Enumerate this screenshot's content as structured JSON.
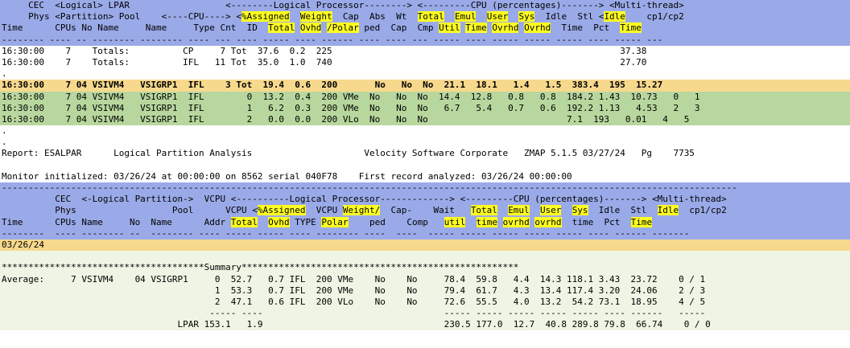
{
  "colors": {
    "header": "#9aaae8",
    "summary_row": "#f7d98e",
    "detail_row": "#b8d79e",
    "report_bg": "#eef5e4",
    "highlight": "#ffff20"
  },
  "top_header": {
    "line1": [
      {
        "t": "     CEC  ",
        "h": false
      },
      {
        "t": "Phys <Partition> LPAR     <----CPU----> <",
        "h": false
      },
      {
        "t": "%Assigned",
        "h": true
      },
      {
        "t": "  ",
        "h": false
      },
      {
        "t": "Weight",
        "h": true
      },
      {
        "t": "  Cap  Abs  Wt  ",
        "h": false
      },
      {
        "t": "Total",
        "h": true
      },
      {
        "t": "  ",
        "h": false
      },
      {
        "t": "Emul",
        "h": true
      },
      {
        "t": "  ",
        "h": false
      },
      {
        "t": "User",
        "h": true
      },
      {
        "t": "  ",
        "h": false
      },
      {
        "t": "Sys",
        "h": true
      },
      {
        "t": "  Idle  Stl <",
        "h": false
      },
      {
        "t": "Idle",
        "h": true
      },
      {
        "t": "    cp1/cp2",
        "h": false
      }
    ],
    "line0": "     CEC  <Logical> LPAR                  <--------Logical Processor--------> <---------CPU (percentages)-------> <Multi-thread>",
    "line1_text": "     Phys <Partition> Pool    <----CPU---->",
    "line2": "Time      CPUs No Name     Name     Type Cnt  ID  ",
    "line2_hl": [
      {
        "t": "Total",
        "h": true
      },
      {
        "t": " ",
        "h": false
      },
      {
        "t": "Ovhd",
        "h": true
      },
      {
        "t": " ",
        "h": false
      },
      {
        "t": "/Polar",
        "h": true
      },
      {
        "t": " ped  Cap  Cmp ",
        "h": false
      },
      {
        "t": "Util",
        "h": true
      },
      {
        "t": " ",
        "h": false
      },
      {
        "t": "Time",
        "h": true
      },
      {
        "t": " ",
        "h": false
      },
      {
        "t": "Ovrhd",
        "h": true
      },
      {
        "t": " ",
        "h": false
      },
      {
        "t": "Ovrhd",
        "h": true
      },
      {
        "t": "  Time  Pct  ",
        "h": false
      },
      {
        "t": "Time",
        "h": true
      }
    ],
    "dashes": "-------- ---- -- -------- -------- ---- --- ---- ----- ---- ------ ---- ---- --- ----- ---- ----- ----- ----- ---- ----- ---"
  },
  "top_rows": [
    {
      "style": "white",
      "text": "16:30:00    7    Totals:          CP     7 Tot  37.6  0.2  225                                                      37.38"
    },
    {
      "style": "white",
      "text": "16:30:00    7    Totals:          IFL   11 Tot  35.0  1.0  740                                                      27.70"
    },
    {
      "style": "white",
      "text": "."
    },
    {
      "style": "orange",
      "text": "16:30:00    7 04 VSIVM4   VSIGRP1  IFL    3 Tot  19.4  0.6  200       No   No  No  21.1  18.1   1.4   1.5  383.4  195  15.27",
      "bold": true
    },
    {
      "style": "green",
      "text": "16:30:00    7 04 VSIVM4   VSIGRP1  IFL        0  13.2  0.4  200 VMe  No   No  No  14.4  12.8   0.8   0.8  184.2 1.43  10.73   0   1"
    },
    {
      "style": "green",
      "text": "16:30:00    7 04 VSIVM4   VSIGRP1  IFL        1   6.2  0.3  200 VMe  No   No  No   6.7   5.4   0.7   0.6  192.2 1.13   4.53   2   3"
    },
    {
      "style": "green",
      "text": "16:30:00    7 04 VSIVM4   VSIGRP1  IFL        2   0.0  0.0  200 VLo  No   No  No                          7.1  193   0.01   4   5"
    },
    {
      "style": "white",
      "text": "."
    },
    {
      "style": "white",
      "text": "."
    }
  ],
  "report": {
    "report_line": "Report: ESALPAR      Logical Partition Analysis                     Velocity Software Corporate   ZMAP 5.1.5 03/27/24   Pg    7735",
    "blank": "",
    "monitor_line": "Monitor initialized: 03/26/24 at 00:00:00 on 8562 serial 040F78    First record analyzed: 03/26/24 00:00:00",
    "rule": "------------------------------------------------------------------------------------------------------------------------------------------"
  },
  "second_header": {
    "line0": "          CEC  <-Logical Partition->  VCPU <----------Logical Processor-------------> <---------CPU (percentages)-------> <Multi-thread>",
    "line1": [
      {
        "t": "          Phys                  Pool      VCPU <",
        "h": false
      },
      {
        "t": "%Assigned",
        "h": true
      },
      {
        "t": "  VCPU ",
        "h": false
      },
      {
        "t": "Weight/",
        "h": true
      },
      {
        "t": "  Cap-    Wait   ",
        "h": false
      },
      {
        "t": "Total",
        "h": true
      },
      {
        "t": "  ",
        "h": false
      },
      {
        "t": "Emul",
        "h": true
      },
      {
        "t": "  ",
        "h": false
      },
      {
        "t": "User",
        "h": true
      },
      {
        "t": "  ",
        "h": false
      },
      {
        "t": "Sys",
        "h": true
      },
      {
        "t": "  Idle  Stl  ",
        "h": false
      },
      {
        "t": "Idle",
        "h": true
      },
      {
        "t": "  cp1/cp2",
        "h": false
      }
    ],
    "line2": [
      {
        "t": "Time      CPUs Name     No  Name      Addr ",
        "h": false
      },
      {
        "t": "Total",
        "h": true
      },
      {
        "t": "  ",
        "h": false
      },
      {
        "t": "Ovhd",
        "h": true
      },
      {
        "t": " TYPE ",
        "h": false
      },
      {
        "t": "Polar",
        "h": true
      },
      {
        "t": "    ped    Comp   ",
        "h": false
      },
      {
        "t": "util",
        "h": true
      },
      {
        "t": "  ",
        "h": false
      },
      {
        "t": "time",
        "h": true
      },
      {
        "t": " ",
        "h": false
      },
      {
        "t": "ovrhd",
        "h": true
      },
      {
        "t": " ",
        "h": false
      },
      {
        "t": "ovrhd",
        "h": true
      },
      {
        "t": "  time  Pct  ",
        "h": false
      },
      {
        "t": "Time",
        "h": true
      }
    ],
    "dashes": "--------  ---- -------- --  -------- ---- ----- ----- ---- -------- ----  ----  ----- ----- ----- ----- ----- ---- ------ -------"
  },
  "date_row": "03/26/24",
  "summary": {
    "blank": "",
    "banner": "**************************************Summary****************************************************",
    "rows": [
      "Average:     7 VSIVM4    04 VSIGRP1     0  52.7   0.7 IFL  200 VMe    No    No     78.4  59.8   4.4  14.3 118.1 3.43  23.72    0 / 1",
      "                                        1  53.3   0.7 IFL  200 VMe    No    No     79.4  61.7   4.3  13.4 117.4 3.20  24.06    2 / 3",
      "                                        2  47.1   0.6 IFL  200 VLo    No    No     72.6  55.5   4.0  13.2  54.2 73.1  18.95    4 / 5",
      "                                       ----- ----                                  ----- ----- ----- ----- ----- ---- ------   -----",
      "                                 LPAR 153.1   1.9                                  230.5 177.0  12.7  40.8 289.8 79.8  66.74    0 / 0"
    ]
  }
}
